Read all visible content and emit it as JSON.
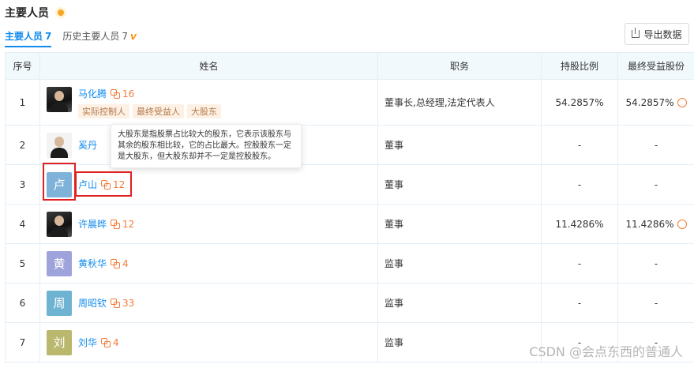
{
  "header": {
    "title": "主要人员"
  },
  "tabs": [
    {
      "label": "主要人员",
      "count": "7"
    },
    {
      "label": "历史主要人员",
      "count": "7"
    }
  ],
  "export_label": "导出数据",
  "columns": [
    "序号",
    "姓名",
    "职务",
    "持股比例",
    "最终受益股份"
  ],
  "rows": [
    {
      "index": "1",
      "avatar": "",
      "name": "马化腾",
      "relations": "16",
      "tags": [
        "实际控制人",
        "最终受益人",
        "大股东"
      ],
      "position": "董事长,总经理,法定代表人",
      "share": "54.2857%",
      "benefit": "54.2857%"
    },
    {
      "index": "2",
      "avatar": "",
      "name": "奚丹",
      "relations": "",
      "tags": [],
      "position": "董事",
      "share": "-",
      "benefit": "-"
    },
    {
      "index": "3",
      "avatar": "卢",
      "name": "卢山",
      "relations": "12",
      "tags": [],
      "position": "董事",
      "share": "-",
      "benefit": "-"
    },
    {
      "index": "4",
      "avatar": "",
      "name": "许晨晔",
      "relations": "12",
      "tags": [],
      "position": "董事",
      "share": "11.4286%",
      "benefit": "11.4286%"
    },
    {
      "index": "5",
      "avatar": "黄",
      "name": "黄秋华",
      "relations": "4",
      "tags": [],
      "position": "监事",
      "share": "-",
      "benefit": "-"
    },
    {
      "index": "6",
      "avatar": "周",
      "name": "周昭钦",
      "relations": "33",
      "tags": [],
      "position": "监事",
      "share": "-",
      "benefit": "-"
    },
    {
      "index": "7",
      "avatar": "刘",
      "name": "刘华",
      "relations": "4",
      "tags": [],
      "position": "监事",
      "share": "-",
      "benefit": "-"
    }
  ],
  "tooltip": "大股东是指股票占比较大的股东，它表示该股东与其余的股东相比较，它的占比最大。控股股东一定是大股东，但大股东却并不一定是控股股东。",
  "watermark": "CSDN @会点东西的普通人",
  "colors": {
    "accent": "#128bed",
    "relation": "#f47b38",
    "highlight": "#e02020",
    "avatar_lu": "#7fb2d9",
    "avatar_huang": "#9fa3db",
    "avatar_zhou": "#6fb3d2",
    "avatar_liu": "#b9b86e"
  }
}
